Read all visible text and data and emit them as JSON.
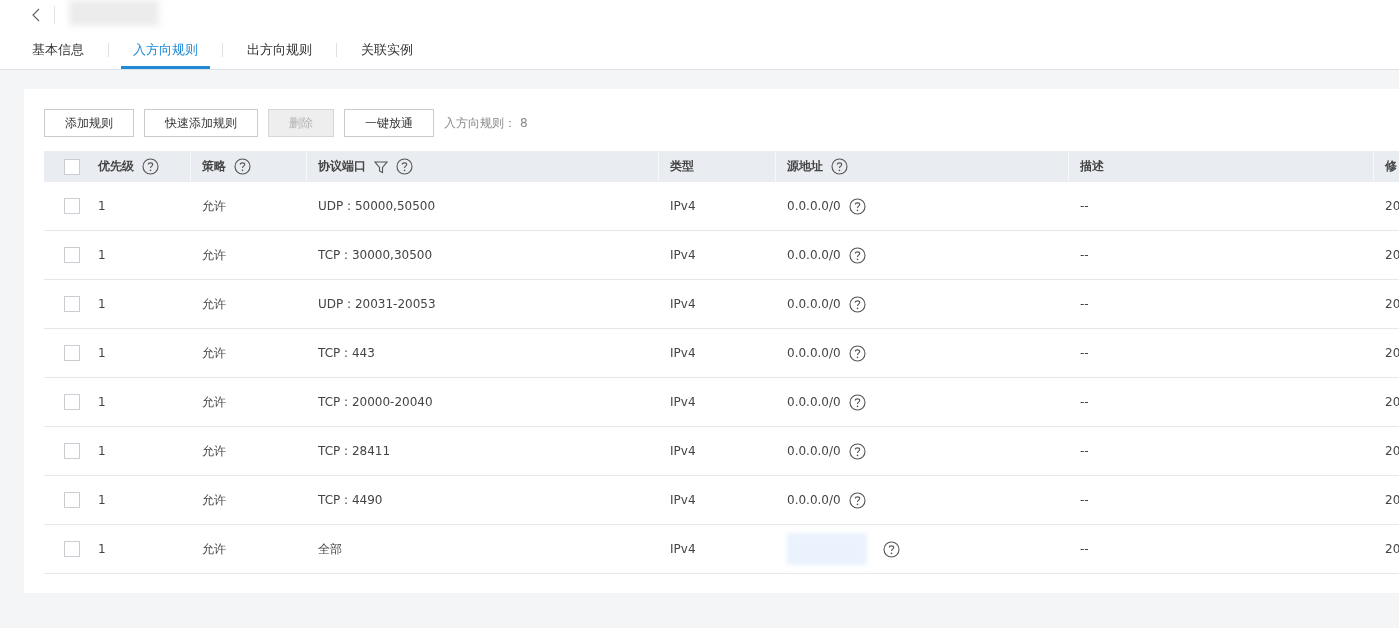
{
  "header": {
    "title_blurred": true
  },
  "tabs": [
    {
      "label": "基本信息",
      "selected": false
    },
    {
      "label": "入方向规则",
      "selected": true
    },
    {
      "label": "出方向规则",
      "selected": false
    },
    {
      "label": "关联实例",
      "selected": false
    }
  ],
  "toolbar": {
    "buttons": [
      {
        "label": "添加规则",
        "disabled": false
      },
      {
        "label": "快速添加规则",
        "disabled": false
      },
      {
        "label": "删除",
        "disabled": true
      },
      {
        "label": "一键放通",
        "disabled": false
      }
    ],
    "count_label": "入方向规则：",
    "count": "8"
  },
  "table": {
    "select_all_checked": false,
    "columns": [
      {
        "label": "优先级",
        "help": true,
        "filter": false
      },
      {
        "label": "策略",
        "help": true,
        "filter": false
      },
      {
        "label": "协议端口",
        "help": true,
        "filter": true
      },
      {
        "label": "类型",
        "help": false,
        "filter": false
      },
      {
        "label": "源地址",
        "help": true,
        "filter": false
      },
      {
        "label": "描述",
        "help": false,
        "filter": false
      },
      {
        "label": "修",
        "help": false,
        "filter": false
      }
    ],
    "rows": [
      {
        "checked": false,
        "priority": "1",
        "policy": "允许",
        "port": "UDP : 50000,50500",
        "type": "IPv4",
        "source": "0.0.0.0/0",
        "source_blurred": false,
        "description": "--",
        "column_7": "20"
      },
      {
        "checked": false,
        "priority": "1",
        "policy": "允许",
        "port": "TCP : 30000,30500",
        "type": "IPv4",
        "source": "0.0.0.0/0",
        "source_blurred": false,
        "description": "--",
        "column_7": "20"
      },
      {
        "checked": false,
        "priority": "1",
        "policy": "允许",
        "port": "UDP : 20031-20053",
        "type": "IPv4",
        "source": "0.0.0.0/0",
        "source_blurred": false,
        "description": "--",
        "column_7": "20"
      },
      {
        "checked": false,
        "priority": "1",
        "policy": "允许",
        "port": "TCP : 443",
        "type": "IPv4",
        "source": "0.0.0.0/0",
        "source_blurred": false,
        "description": "--",
        "column_7": "20"
      },
      {
        "checked": false,
        "priority": "1",
        "policy": "允许",
        "port": "TCP : 20000-20040",
        "type": "IPv4",
        "source": "0.0.0.0/0",
        "source_blurred": false,
        "description": "--",
        "column_7": "20"
      },
      {
        "checked": false,
        "priority": "1",
        "policy": "允许",
        "port": "TCP : 28411",
        "type": "IPv4",
        "source": "0.0.0.0/0",
        "source_blurred": false,
        "description": "--",
        "column_7": "20"
      },
      {
        "checked": false,
        "priority": "1",
        "policy": "允许",
        "port": "TCP : 4490",
        "type": "IPv4",
        "source": "0.0.0.0/0",
        "source_blurred": false,
        "description": "--",
        "column_7": "20"
      },
      {
        "checked": false,
        "priority": "1",
        "policy": "允许",
        "port": "全部",
        "type": "IPv4",
        "source_blurred": true,
        "description": "--",
        "column_7": "20"
      }
    ]
  }
}
